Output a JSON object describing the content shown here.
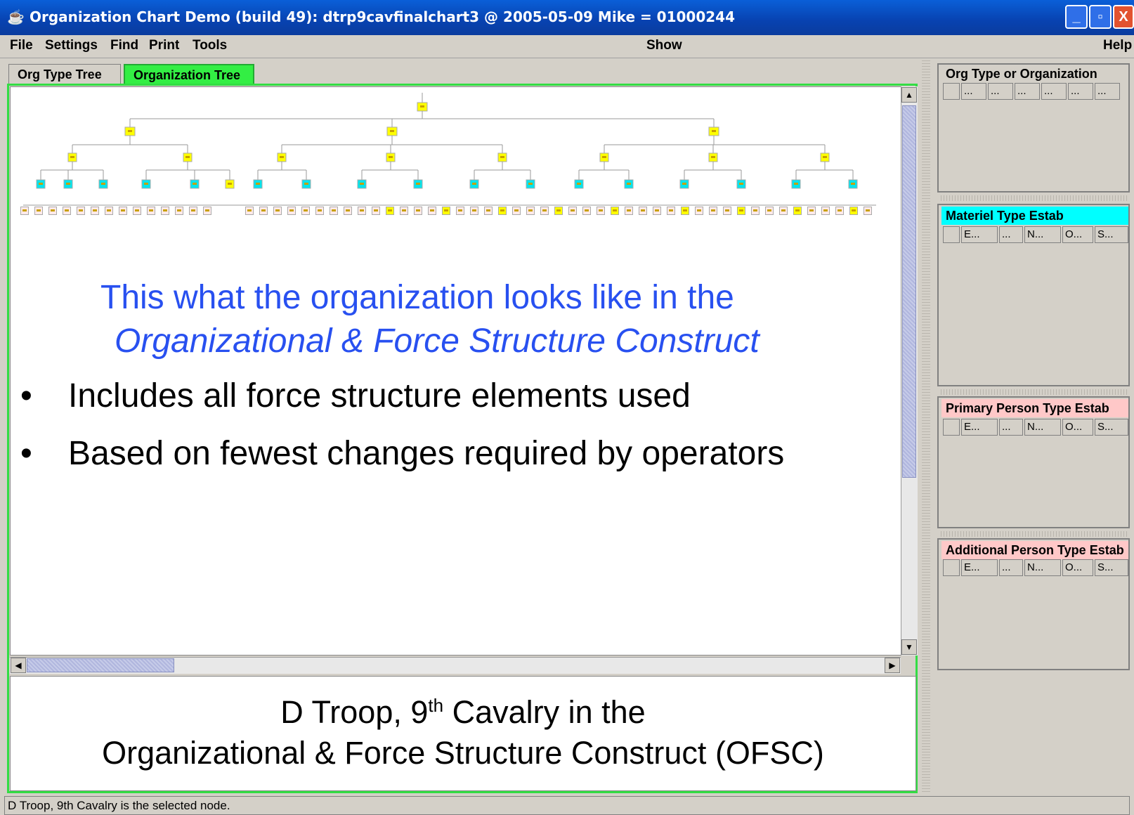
{
  "window": {
    "title": "Organization Chart Demo (build 49): dtrp9cavfinalchart3 @ 2005-05-09 Mike = 01000244",
    "minimize_glyph": "_",
    "maximize_glyph": "▫",
    "close_glyph": "X"
  },
  "menu": {
    "file": "File",
    "settings": "Settings",
    "find": "Find",
    "print": "Print",
    "tools": "Tools",
    "show": "Show",
    "help": "Help"
  },
  "tabs": [
    {
      "label": "Org Type Tree",
      "selected": false
    },
    {
      "label": "Organization Tree",
      "selected": true
    }
  ],
  "slide": {
    "heading_line1": "This what the organization looks like in the",
    "heading_line2": "Organizational & Force Structure Construct",
    "bullets": [
      "Includes all force structure elements used",
      "Based on fewest changes required by operators"
    ],
    "caption_line1_pre": "D Troop, 9",
    "caption_line1_sup": "th",
    "caption_line1_post": " Cavalry in the",
    "caption_line2": "Organizational & Force Structure Construct (OFSC)"
  },
  "right_panels": [
    {
      "title": "Org Type or Organization",
      "color": "#d4d0c8",
      "columns": [
        "",
        "...",
        "...",
        "...",
        "...",
        "...",
        "..."
      ]
    },
    {
      "title": "Materiel Type Estab",
      "color": "#00ffff",
      "columns": [
        "",
        "E...",
        "...",
        "N...",
        "O...",
        "S..."
      ]
    },
    {
      "title": "Primary Person Type Estab",
      "color": "#ffc8c8",
      "columns": [
        "",
        "E...",
        "...",
        "N...",
        "O...",
        "S..."
      ]
    },
    {
      "title": "Additional Person Type Estab",
      "color": "#ffc8c8",
      "columns": [
        "",
        "E...",
        "...",
        "N...",
        "O...",
        "S..."
      ]
    }
  ],
  "org_tree": {
    "node_colors": {
      "org": "#ffff00",
      "unit": "#00e5ee",
      "leaf": "#ffeaea"
    }
  },
  "status": {
    "text": "D Troop, 9th Cavalry is the selected node."
  },
  "icons": {
    "app": "java-cup-icon",
    "scroll_up": "▲",
    "scroll_down": "▼",
    "scroll_left": "◀",
    "scroll_right": "▶"
  }
}
